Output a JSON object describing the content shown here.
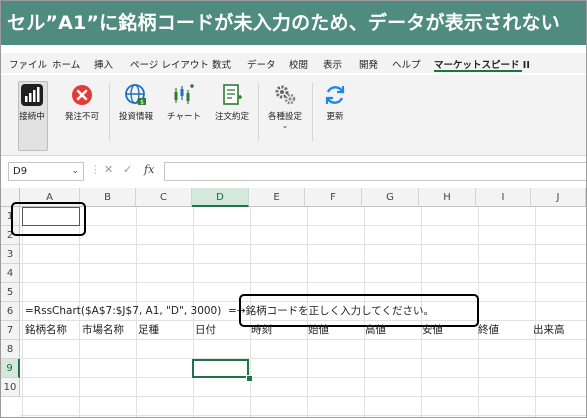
{
  "banner": {
    "title": "セル”A1”に銘柄コードが未入力のため、データが表示されない"
  },
  "menu": {
    "tabs": [
      "ファイル",
      "ホーム",
      "挿入",
      "ページ レイアウト",
      "数式",
      "データ",
      "校閲",
      "表示",
      "開発",
      "ヘルプ",
      "マーケットスピード II"
    ],
    "active_tab": "マーケットスピード II"
  },
  "ribbon": {
    "buttons": [
      {
        "label": "接続中",
        "icon": "connection-signal-icon"
      },
      {
        "label": "発注不可",
        "icon": "no-order-icon"
      },
      {
        "label": "投資情報",
        "icon": "globe-investment-icon"
      },
      {
        "label": "チャート",
        "icon": "chart-icon"
      },
      {
        "label": "注文約定",
        "icon": "order-document-icon"
      },
      {
        "label": "各種設定",
        "icon": "gears-icon",
        "caret": "⌄"
      },
      {
        "label": "更新",
        "icon": "refresh-icon"
      }
    ]
  },
  "formula_bar": {
    "name_box": "D9",
    "fx": "fx",
    "cancel": "✕",
    "enter": "✓",
    "formula": ""
  },
  "sheet": {
    "columns": [
      "A",
      "B",
      "C",
      "D",
      "E",
      "F",
      "G",
      "H",
      "I",
      "J"
    ],
    "selected_column": "D",
    "rows": [
      "1",
      "2",
      "3",
      "4",
      "5",
      "6",
      "7",
      "8",
      "9",
      "10"
    ],
    "selected_row": "9",
    "active_cell": "D9",
    "row6_formula": "=RssChart($A$7:$J$7, A1, \"D\", 3000)",
    "row6_result": "=→銘柄コードを正しく入力してください。",
    "row7_headers": [
      "銘柄名称",
      "市場名称",
      "足種",
      "日付",
      "時刻",
      "始値",
      "高値",
      "安値",
      "終値",
      "出来高"
    ]
  },
  "colors": {
    "banner": "#4f8b7e",
    "excel_green": "#217346"
  }
}
